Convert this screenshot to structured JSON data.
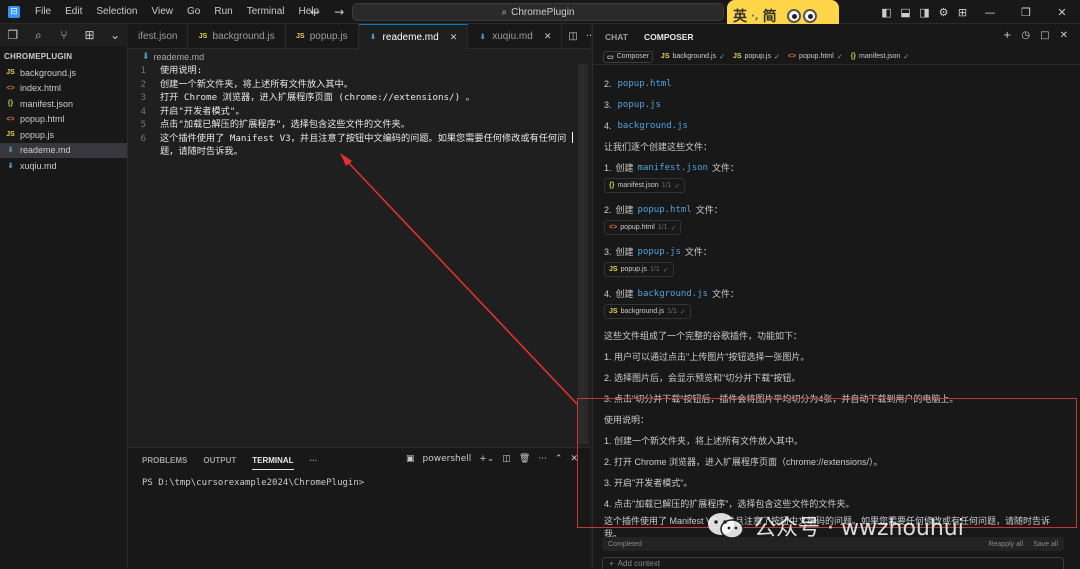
{
  "menu": [
    "File",
    "Edit",
    "Selection",
    "View",
    "Go",
    "Run",
    "Terminal",
    "Help"
  ],
  "nav": {
    "back": "←",
    "forward": "→"
  },
  "command_center": "ChromePlugin",
  "ime": {
    "mode": "英",
    "sep": "·,",
    "simp": "简"
  },
  "explorer": {
    "title": "CHROMEPLUGIN",
    "files": [
      {
        "icon": "JS",
        "name": "background.js",
        "color": "#e8d44d"
      },
      {
        "icon": "<>",
        "name": "index.html",
        "color": "#e37933"
      },
      {
        "icon": "{}",
        "name": "manifest.json",
        "color": "#cbcb41"
      },
      {
        "icon": "<>",
        "name": "popup.html",
        "color": "#e37933"
      },
      {
        "icon": "JS",
        "name": "popup.js",
        "color": "#e8d44d"
      },
      {
        "icon": "⬇",
        "name": "reademe.md",
        "color": "#519aba"
      },
      {
        "icon": "⬇",
        "name": "xuqiu.md",
        "color": "#519aba"
      }
    ]
  },
  "tabs": [
    {
      "name": "ifest.json",
      "icon": "",
      "color": "#cbcb41"
    },
    {
      "name": "background.js",
      "icon": "JS",
      "color": "#e8d44d"
    },
    {
      "name": "popup.js",
      "icon": "JS",
      "color": "#e8d44d"
    },
    {
      "name": "reademe.md",
      "icon": "⬇",
      "color": "#519aba"
    },
    {
      "name": "xuqiu.md",
      "icon": "⬇",
      "color": "#519aba"
    }
  ],
  "breadcrumb": "reademe.md",
  "editor_lines": [
    {
      "n": "1",
      "text": "使用说明:"
    },
    {
      "n": "2",
      "text": "创建一个新文件夹，将上述所有文件放入其中。"
    },
    {
      "n": "3",
      "text": "打开 Chrome 浏览器，进入扩展程序页面 (chrome://extensions/) 。"
    },
    {
      "n": "4",
      "text": "开启\"开发者模式\"。"
    },
    {
      "n": "5",
      "text": "点击\"加载已解压的扩展程序\"，选择包含这些文件的文件夹。"
    },
    {
      "n": "6",
      "text": "这个插件使用了 Manifest V3，并且注意了按钮中文编码的问题。如果您需要任何修改或有任何问题，请随时告诉我。"
    }
  ],
  "panel": {
    "tabs": [
      "PROBLEMS",
      "OUTPUT",
      "TERMINAL",
      "···"
    ],
    "shell": "powershell",
    "prompt": "PS D:\\tmp\\cursorexample2024\\ChromePlugin>"
  },
  "composer": {
    "tabs": [
      "CHAT",
      "COMPOSER"
    ],
    "chips": [
      {
        "icon": "▭",
        "name": "Composer"
      },
      {
        "icon": "JS",
        "name": "background.js"
      },
      {
        "icon": "JS",
        "name": "popup.js"
      },
      {
        "icon": "<>",
        "name": "popup.html"
      },
      {
        "icon": "{}",
        "name": "manifest.json"
      }
    ],
    "list": [
      {
        "num": "2.",
        "file": "popup.html"
      },
      {
        "num": "3.",
        "file": "popup.js"
      },
      {
        "num": "4.",
        "file": "background.js"
      }
    ],
    "intro": "让我们逐个创建这些文件：",
    "steps": [
      {
        "num": "1.",
        "pre": "创建",
        "file": "manifest.json",
        "post": "文件：",
        "chip_icon": "{}",
        "chip_name": "manifest.json",
        "chip_meta": "1/1"
      },
      {
        "num": "2.",
        "pre": "创建",
        "file": "popup.html",
        "post": "文件：",
        "chip_icon": "<>",
        "chip_name": "popup.html",
        "chip_meta": "1/1"
      },
      {
        "num": "3.",
        "pre": "创建",
        "file": "popup.js",
        "post": "文件：",
        "chip_icon": "JS",
        "chip_name": "popup.js",
        "chip_meta": "1/1"
      },
      {
        "num": "4.",
        "pre": "创建",
        "file": "background.js",
        "post": "文件：",
        "chip_icon": "JS",
        "chip_name": "background.js",
        "chip_meta": "1/1"
      }
    ],
    "summary": "这些文件组成了一个完整的谷歌插件，功能如下：",
    "features": [
      "1. 用户可以通过点击\"上传图片\"按钮选择一张图片。",
      "2. 选择图片后，会显示预览和\"切分并下载\"按钮。",
      "3. 点击\"切分并下载\"按钮后，插件会将图片平均切分为4张，并自动下载到用户的电脑上。"
    ],
    "usage_title": "使用说明：",
    "usage": [
      "1. 创建一个新文件夹，将上述所有文件放入其中。",
      "2. 打开 Chrome 浏览器，进入扩展程序页面（chrome://extensions/）。",
      "3. 开启\"开发者模式\"。",
      "4. 点击\"加载已解压的扩展程序\"，选择包含这些文件的文件夹。"
    ],
    "usage_note_1": "这个插件使用了 Manifest V3，并且注意了按钮中文编码的问题。如果您需要任何修改或有任何问题，请随时告诉",
    "usage_note_2": "我。",
    "status": "Completed",
    "reapply": "Reapply all",
    "save_all": "Save all",
    "add_context": "Add context"
  },
  "watermark": "公众号 · wwzhouhui",
  "colors": {
    "accent": "#0078d4",
    "link": "#4fa3e0",
    "annotation": "#e03030",
    "ime_bg": "#ffd54a"
  }
}
